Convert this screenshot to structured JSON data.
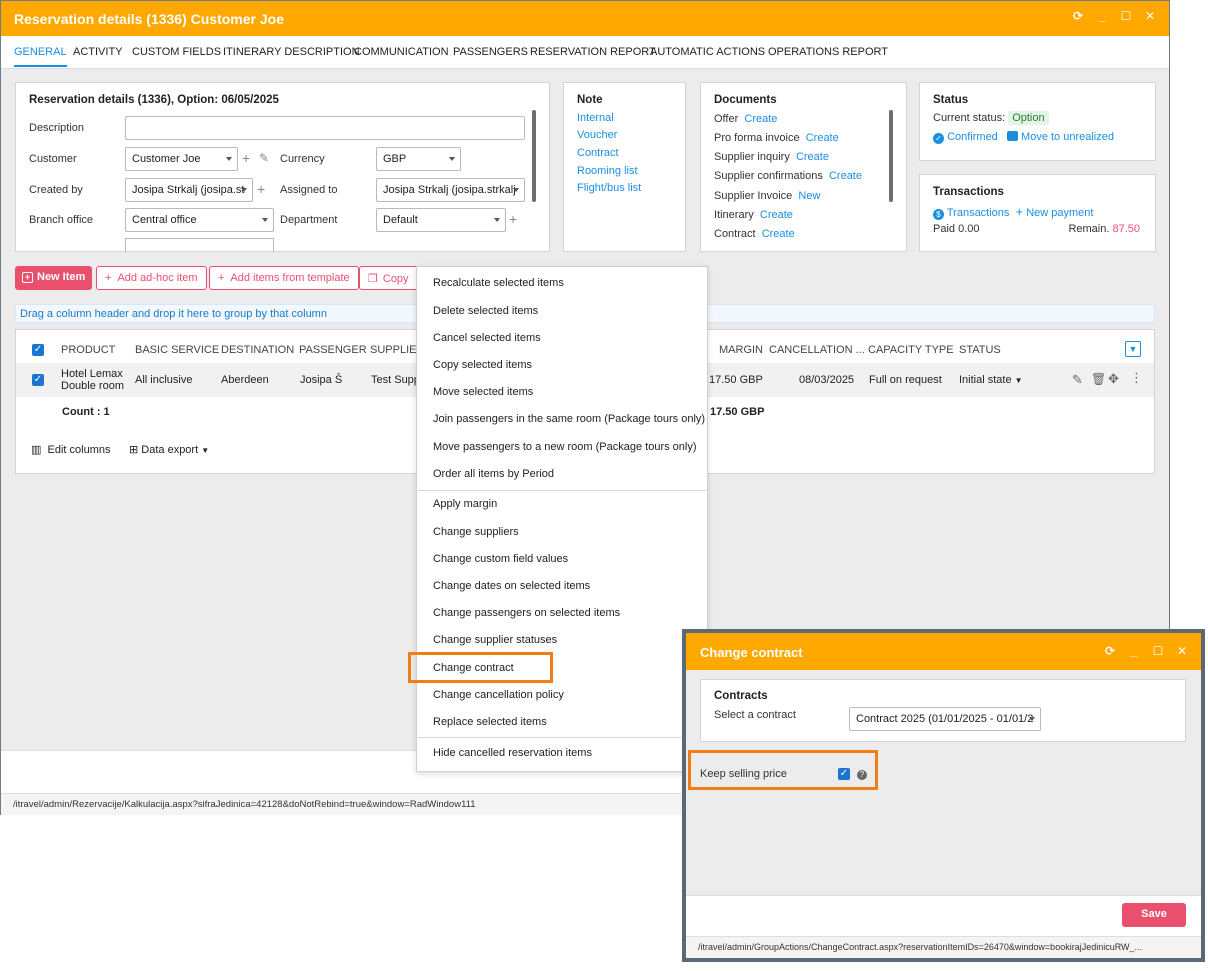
{
  "main_window": {
    "title": "Reservation details (1336) Customer Joe",
    "title_icons": [
      "refresh-icon",
      "minimize-icon",
      "maximize-icon",
      "close-icon"
    ],
    "tabs": [
      "GENERAL",
      "ACTIVITY",
      "CUSTOM FIELDS",
      "ITINERARY DESCRIPTION",
      "COMMUNICATION",
      "PASSENGERS",
      "RESERVATION REPORT",
      "AUTOMATIC ACTIONS",
      "OPERATIONS REPORT"
    ],
    "active_tab": "GENERAL"
  },
  "details": {
    "heading": "Reservation details (1336), Option: 06/05/2025",
    "description_label": "Description",
    "description_value": "",
    "customer_label": "Customer",
    "customer_value": "Customer  Joe",
    "currency_label": "Currency",
    "currency_value": "GBP",
    "created_by_label": "Created by",
    "created_by_value": "Josipa Strkalj (josipa.st",
    "assigned_to_label": "Assigned to",
    "assigned_to_value": "Josipa Strkalj (josipa.strkalj",
    "branch_label": "Branch office",
    "branch_value": "Central office",
    "department_label": "Department",
    "department_value": "Default"
  },
  "note": {
    "title": "Note",
    "links": [
      "Internal",
      "Voucher",
      "Contract",
      "Rooming list",
      "Flight/bus list"
    ]
  },
  "documents": {
    "title": "Documents",
    "rows": [
      {
        "label": "Offer",
        "action": "Create"
      },
      {
        "label": "Pro forma invoice",
        "action": "Create"
      },
      {
        "label": "Supplier inquiry",
        "action": "Create"
      },
      {
        "label": "Supplier confirmations",
        "action": "Create"
      },
      {
        "label": "Supplier Invoice",
        "action": "New"
      },
      {
        "label": "Itinerary",
        "action": "Create"
      },
      {
        "label": "Contract",
        "action": "Create"
      }
    ]
  },
  "status": {
    "title": "Status",
    "current_label": "Current status:",
    "current_value": "Option",
    "confirmed": "Confirmed",
    "move": "Move to unrealized"
  },
  "transactions": {
    "title": "Transactions",
    "link": "Transactions",
    "new_payment": "New payment",
    "paid": "Paid 0.00",
    "remain_label": "Remain.",
    "remain_value": "87.50"
  },
  "toolbar": {
    "new_item": "New Item",
    "add_adhoc": "Add ad-hoc item",
    "add_template": "Add items from template",
    "copy": "Copy"
  },
  "grid": {
    "group_hint": "Drag a column header and drop it here to group by that column",
    "headers": [
      "PRODUCT",
      "BASIC SERVICE",
      "DESTINATION",
      "PASSENGER",
      "SUPPLIER",
      "MARGIN",
      "CANCELLATION ...",
      "CAPACITY TYPE",
      "STATUS"
    ],
    "row": {
      "product": "Hotel Lemax",
      "product_sub": "Double room",
      "basic_service": "All inclusive",
      "destination": "Aberdeen",
      "passenger": "Josipa Š",
      "supplier": "Test Supp",
      "margin": "17.50 GBP",
      "cancellation": "08/03/2025",
      "capacity": "Full on request",
      "status": "Initial state"
    },
    "footer_count": "Count : 1",
    "footer_margin": "17.50 GBP",
    "edit_columns": "Edit columns",
    "data_export": "Data export"
  },
  "context_menu": {
    "group1": [
      "Recalculate selected items",
      "Delete selected items",
      "Cancel selected items",
      "Copy selected items",
      "Move selected items",
      "Join passengers in the same room (Package tours only)",
      "Move passengers to a new room (Package tours only)",
      "Order all items by Period"
    ],
    "group2": [
      "Apply margin",
      "Change suppliers",
      "Change custom field values",
      "Change dates on selected items",
      "Change passengers on selected items",
      "Change supplier statuses",
      "Change contract",
      "Change cancellation policy",
      "Replace selected items"
    ],
    "group3": [
      "Hide cancelled reservation items"
    ],
    "highlighted": "Change contract"
  },
  "main_status_url": "/itravel/admin/Rezervacije/Kalkulacija.aspx?sifraJedinica=42128&doNotRebind=true&window=RadWindow111",
  "dialog": {
    "title": "Change contract",
    "section_title": "Contracts",
    "select_label": "Select a contract",
    "select_value": "Contract 2025  (01/01/2025 - 01/01/2",
    "keep_label": "Keep selling price",
    "keep_checked": true,
    "save": "Save",
    "url": "/itravel/admin/GroupActions/ChangeContract.aspx?reservationItemIDs=26470&window=bookirajJedinicuRW_..."
  },
  "colors": {
    "titlebar": "#ffa800",
    "accent_blue": "#1a8fe0",
    "brand_pink": "#e8506e",
    "highlight": "#f07d1a",
    "status_green_bg": "#e3f5e6"
  }
}
